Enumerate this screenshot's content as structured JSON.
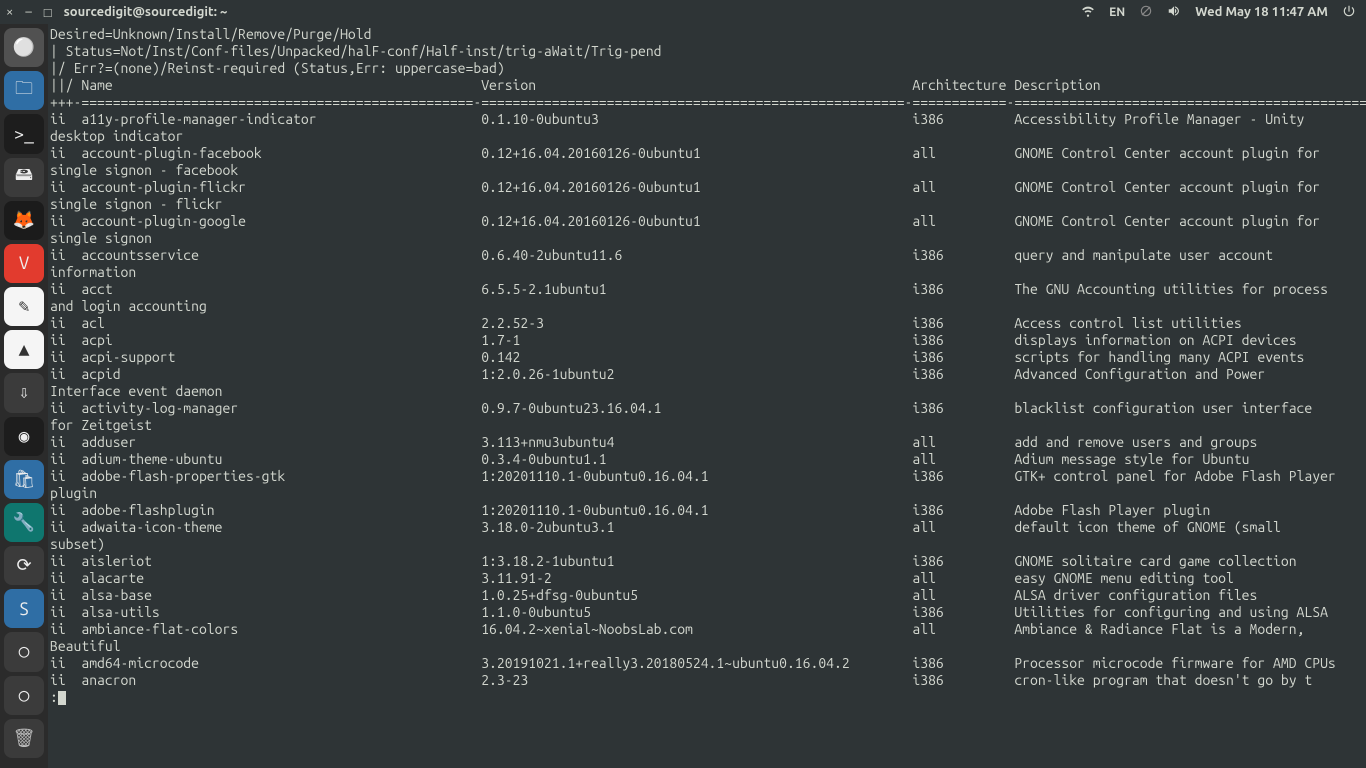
{
  "panel": {
    "window_close": "×",
    "window_min": "–",
    "window_max": "□",
    "title": "sourcedigit@sourcedigit: ~",
    "lang": "EN",
    "clock": "Wed May 18 11:47 AM"
  },
  "launcher": {
    "items": [
      {
        "name": "show-apps",
        "bg": "#515151",
        "glyph": "⚪"
      },
      {
        "name": "files",
        "bg": "#2f6ea5",
        "glyph": "🗀"
      },
      {
        "name": "terminal",
        "bg": "#1d1d1d",
        "glyph": ">_"
      },
      {
        "name": "drive",
        "bg": "#3b3b3b",
        "glyph": "🖴"
      },
      {
        "name": "firefox",
        "bg": "#1b1b1b",
        "glyph": "🦊"
      },
      {
        "name": "vivaldi",
        "bg": "#e23b2e",
        "glyph": "V"
      },
      {
        "name": "text-editor",
        "bg": "#f5f5f5",
        "glyph": "✎"
      },
      {
        "name": "vlc",
        "bg": "#f5f5f5",
        "glyph": "▲"
      },
      {
        "name": "archive",
        "bg": "#3b3b3b",
        "glyph": "⇩"
      },
      {
        "name": "obs",
        "bg": "#1d1d1d",
        "glyph": "◉"
      },
      {
        "name": "software",
        "bg": "#2f6ea5",
        "glyph": "🛍"
      },
      {
        "name": "wrench",
        "bg": "#0f766e",
        "glyph": "🔧"
      },
      {
        "name": "sync",
        "bg": "#3b3b3b",
        "glyph": "⟳"
      },
      {
        "name": "staging",
        "bg": "#2f6ea5",
        "glyph": "S"
      },
      {
        "name": "disk1",
        "bg": "#3b3b3b",
        "glyph": "○"
      },
      {
        "name": "disk2",
        "bg": "#3b3b3b",
        "glyph": "○"
      }
    ],
    "trash": {
      "name": "trash",
      "bg": "#3b3b3b",
      "glyph": "🗑"
    }
  },
  "terminal": {
    "header": [
      "Desired=Unknown/Install/Remove/Purge/Hold",
      "| Status=Not/Inst/Conf-files/Unpacked/halF-conf/Half-inst/trig-aWait/Trig-pend",
      "|/ Err?=(none)/Reinst-required (Status,Err: uppercase=bad)"
    ],
    "col_name": "||/ Name",
    "col_version": "Version",
    "col_arch": "Architecture",
    "col_desc": "Description",
    "sep": "+++-==================================================-======================================================-============-===============================================",
    "packages": [
      {
        "st": "ii",
        "name": "a11y-profile-manager-indicator",
        "ver": "0.1.10-0ubuntu3",
        "arch": "i386",
        "desc": "Accessibility Profile Manager - Unity desktop indicator"
      },
      {
        "st": "ii",
        "name": "account-plugin-facebook",
        "ver": "0.12+16.04.20160126-0ubuntu1",
        "arch": "all",
        "desc": "GNOME Control Center account plugin for single signon - facebook"
      },
      {
        "st": "ii",
        "name": "account-plugin-flickr",
        "ver": "0.12+16.04.20160126-0ubuntu1",
        "arch": "all",
        "desc": "GNOME Control Center account plugin for single signon - flickr"
      },
      {
        "st": "ii",
        "name": "account-plugin-google",
        "ver": "0.12+16.04.20160126-0ubuntu1",
        "arch": "all",
        "desc": "GNOME Control Center account plugin for single signon"
      },
      {
        "st": "ii",
        "name": "accountsservice",
        "ver": "0.6.40-2ubuntu11.6",
        "arch": "i386",
        "desc": "query and manipulate user account information"
      },
      {
        "st": "ii",
        "name": "acct",
        "ver": "6.5.5-2.1ubuntu1",
        "arch": "i386",
        "desc": "The GNU Accounting utilities for process and login accounting"
      },
      {
        "st": "ii",
        "name": "acl",
        "ver": "2.2.52-3",
        "arch": "i386",
        "desc": "Access control list utilities"
      },
      {
        "st": "ii",
        "name": "acpi",
        "ver": "1.7-1",
        "arch": "i386",
        "desc": "displays information on ACPI devices"
      },
      {
        "st": "ii",
        "name": "acpi-support",
        "ver": "0.142",
        "arch": "i386",
        "desc": "scripts for handling many ACPI events"
      },
      {
        "st": "ii",
        "name": "acpid",
        "ver": "1:2.0.26-1ubuntu2",
        "arch": "i386",
        "desc": "Advanced Configuration and Power Interface event daemon"
      },
      {
        "st": "ii",
        "name": "activity-log-manager",
        "ver": "0.9.7-0ubuntu23.16.04.1",
        "arch": "i386",
        "desc": "blacklist configuration user interface for Zeitgeist"
      },
      {
        "st": "ii",
        "name": "adduser",
        "ver": "3.113+nmu3ubuntu4",
        "arch": "all",
        "desc": "add and remove users and groups"
      },
      {
        "st": "ii",
        "name": "adium-theme-ubuntu",
        "ver": "0.3.4-0ubuntu1.1",
        "arch": "all",
        "desc": "Adium message style for Ubuntu"
      },
      {
        "st": "ii",
        "name": "adobe-flash-properties-gtk",
        "ver": "1:20201110.1-0ubuntu0.16.04.1",
        "arch": "i386",
        "desc": "GTK+ control panel for Adobe Flash Player plugin"
      },
      {
        "st": "ii",
        "name": "adobe-flashplugin",
        "ver": "1:20201110.1-0ubuntu0.16.04.1",
        "arch": "i386",
        "desc": "Adobe Flash Player plugin"
      },
      {
        "st": "ii",
        "name": "adwaita-icon-theme",
        "ver": "3.18.0-2ubuntu3.1",
        "arch": "all",
        "desc": "default icon theme of GNOME (small subset)"
      },
      {
        "st": "ii",
        "name": "aisleriot",
        "ver": "1:3.18.2-1ubuntu1",
        "arch": "i386",
        "desc": "GNOME solitaire card game collection"
      },
      {
        "st": "ii",
        "name": "alacarte",
        "ver": "3.11.91-2",
        "arch": "all",
        "desc": "easy GNOME menu editing tool"
      },
      {
        "st": "ii",
        "name": "alsa-base",
        "ver": "1.0.25+dfsg-0ubuntu5",
        "arch": "all",
        "desc": "ALSA driver configuration files"
      },
      {
        "st": "ii",
        "name": "alsa-utils",
        "ver": "1.1.0-0ubuntu5",
        "arch": "i386",
        "desc": "Utilities for configuring and using ALSA"
      },
      {
        "st": "ii",
        "name": "ambiance-flat-colors",
        "ver": "16.04.2~xenial~NoobsLab.com",
        "arch": "all",
        "desc": "Ambiance & Radiance Flat is a Modern, Beautiful"
      },
      {
        "st": "ii",
        "name": "amd64-microcode",
        "ver": "3.20191021.1+really3.20180524.1~ubuntu0.16.04.2",
        "arch": "i386",
        "desc": "Processor microcode firmware for AMD CPUs"
      },
      {
        "st": "ii",
        "name": "anacron",
        "ver": "2.3-23",
        "arch": "i386",
        "desc": "cron-like program that doesn't go by t"
      }
    ],
    "prompt": ":"
  }
}
